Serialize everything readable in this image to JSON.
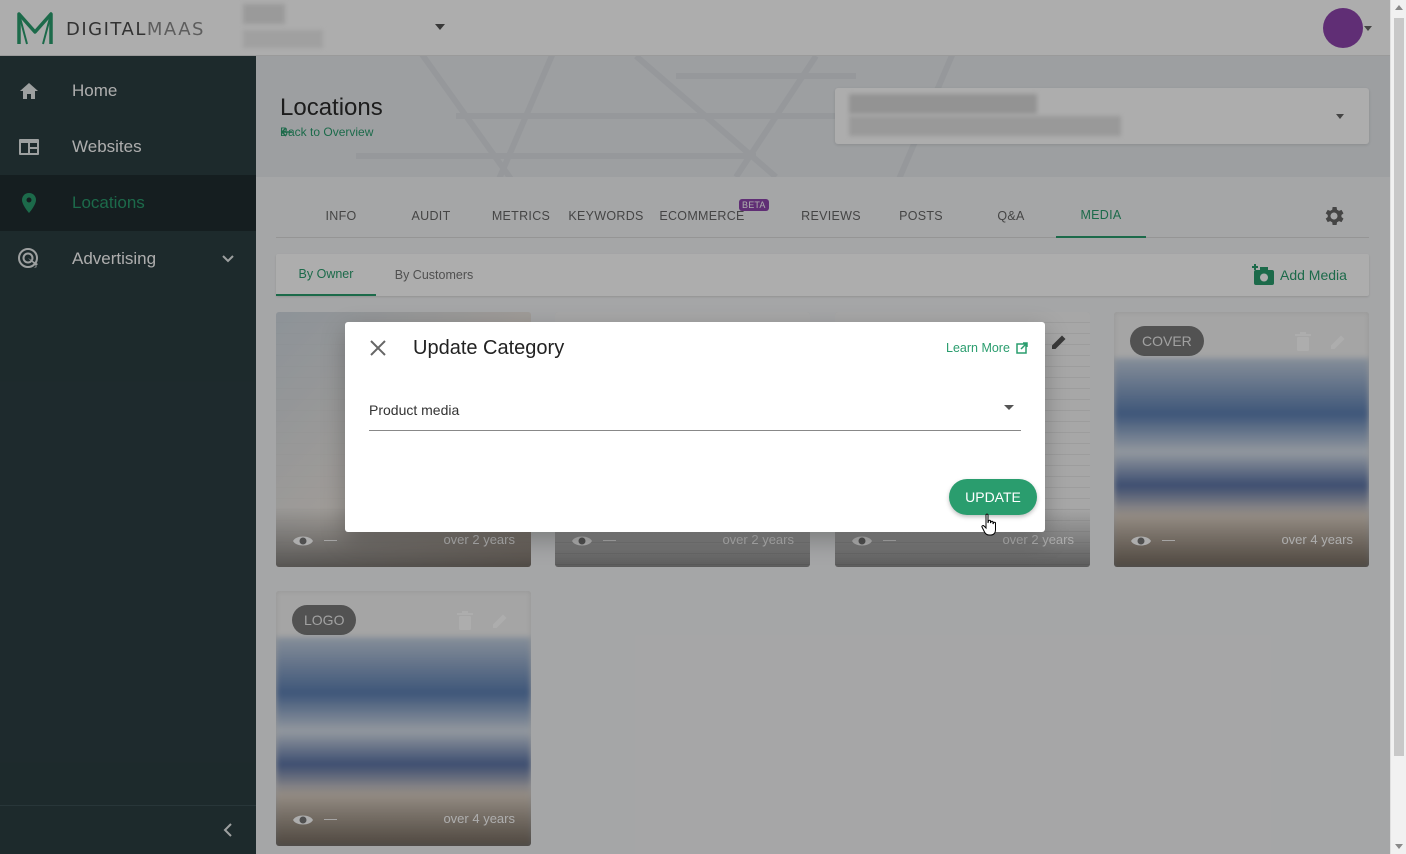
{
  "brand": {
    "name_bold": "DIGITAL",
    "name_light": "MAAS"
  },
  "colors": {
    "accent": "#2a9d6e",
    "sidebar": "#2c3e42",
    "beta": "#8e44ad",
    "avatar": "#8e44ad"
  },
  "sidebar": {
    "items": [
      {
        "label": "Home",
        "icon": "home-icon"
      },
      {
        "label": "Websites",
        "icon": "website-icon"
      },
      {
        "label": "Locations",
        "icon": "location-pin-icon",
        "active": true
      },
      {
        "label": "Advertising",
        "icon": "target-icon",
        "expandable": true
      }
    ]
  },
  "header": {
    "title": "Locations",
    "back_link": "Back to Overview"
  },
  "tabs": [
    {
      "label": "INFO"
    },
    {
      "label": "AUDIT"
    },
    {
      "label": "METRICS"
    },
    {
      "label": "KEYWORDS"
    },
    {
      "label": "ECOMMERCE",
      "badge": "BETA"
    },
    {
      "label": "REVIEWS"
    },
    {
      "label": "POSTS"
    },
    {
      "label": "Q&A"
    },
    {
      "label": "MEDIA",
      "active": true
    }
  ],
  "subtabs": [
    {
      "label": "By Owner",
      "active": true
    },
    {
      "label": "By Customers"
    }
  ],
  "add_media_label": "Add Media",
  "media": [
    {
      "views": "—",
      "age": "over 2 years"
    },
    {
      "views": "—",
      "age": "over 2 years"
    },
    {
      "views": "—",
      "age": "over 2 years"
    },
    {
      "chip": "COVER",
      "views": "—",
      "age": "over 4 years"
    },
    {
      "chip": "LOGO",
      "views": "—",
      "age": "over 4 years"
    }
  ],
  "modal": {
    "title": "Update Category",
    "learn_more": "Learn More",
    "category_value": "Product media",
    "update_label": "UPDATE"
  }
}
